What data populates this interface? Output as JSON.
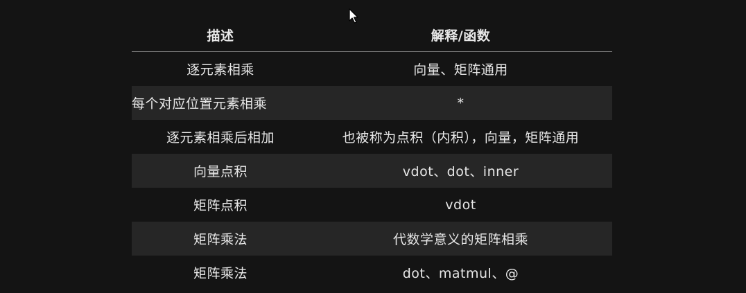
{
  "table": {
    "headers": [
      "描述",
      "解释/函数"
    ],
    "rows": [
      {
        "description": "逐元素相乘",
        "explanation": "向量、矩阵通用"
      },
      {
        "description": "每个对应位置元素相乘",
        "explanation": "*"
      },
      {
        "description": "逐元素相乘后相加",
        "explanation": "也被称为点积（内积），向量，矩阵通用"
      },
      {
        "description": "向量点积",
        "explanation": "vdot、dot、inner"
      },
      {
        "description": "矩阵点积",
        "explanation": "vdot"
      },
      {
        "description": "矩阵乘法",
        "explanation": "代数学意义的矩阵相乘"
      },
      {
        "description": "矩阵乘法",
        "explanation": "dot、matmul、@"
      }
    ]
  },
  "icons": {
    "cursor": "mouse-pointer-icon"
  },
  "colors": {
    "background": "#141414",
    "row_shade": "#262626",
    "text": "#e8e8e8",
    "divider": "#7a7a7a"
  }
}
